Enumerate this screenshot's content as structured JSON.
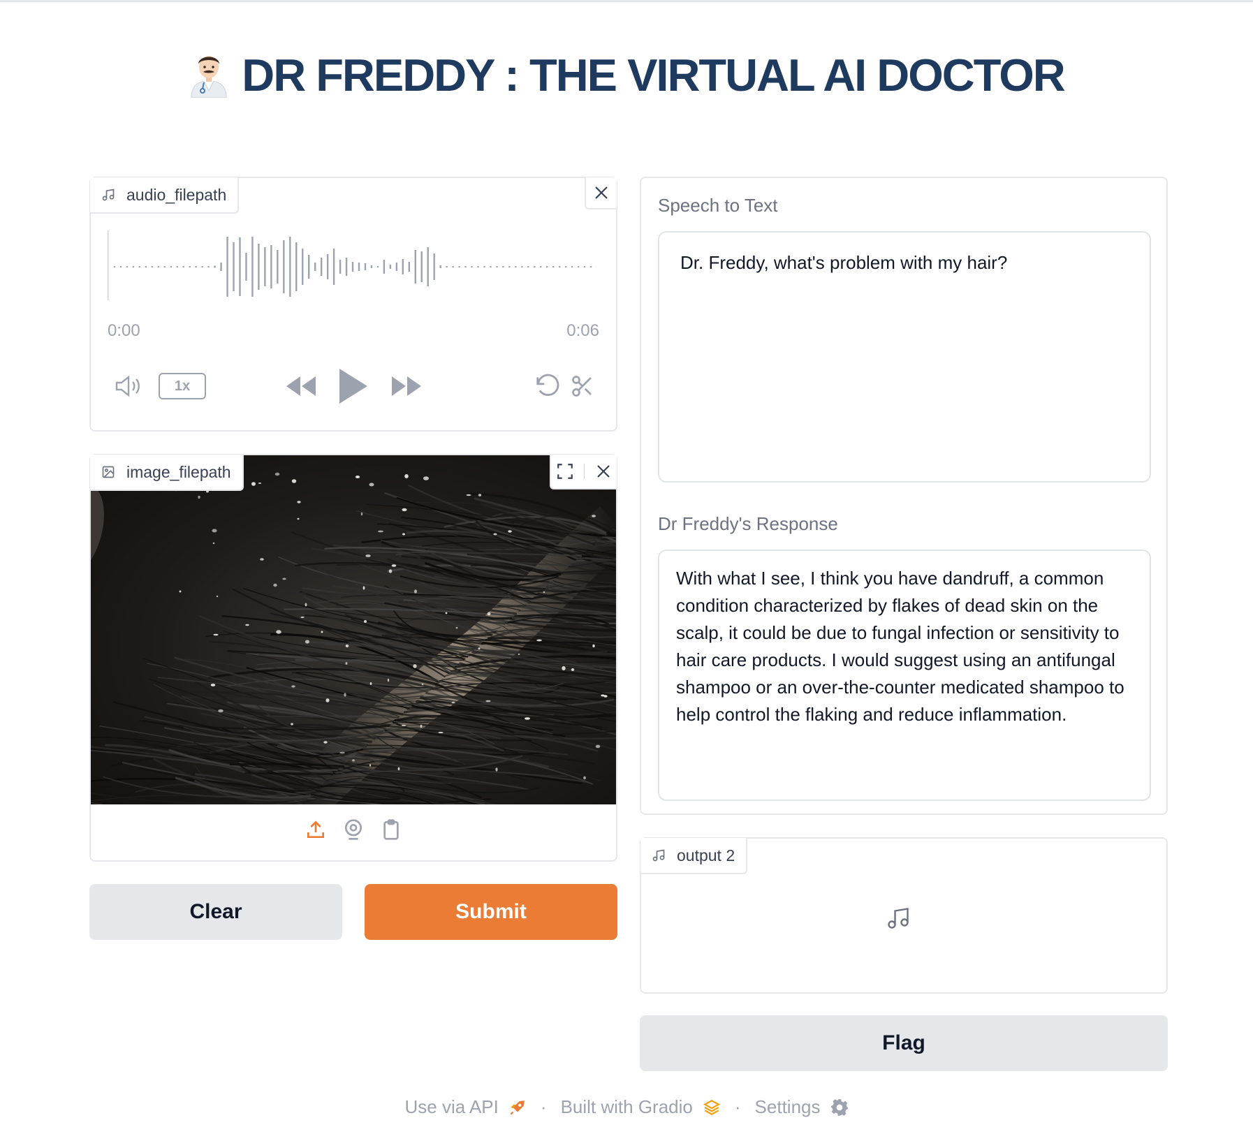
{
  "app": {
    "title": "DR FREDDY : THE VIRTUAL AI DOCTOR"
  },
  "audio": {
    "label": "audio_filepath",
    "time_start": "0:00",
    "time_end": "0:06",
    "speed": "1x"
  },
  "image": {
    "label": "image_filepath"
  },
  "buttons": {
    "clear": "Clear",
    "submit": "Submit",
    "flag": "Flag"
  },
  "speech_to_text": {
    "label": "Speech to Text",
    "value": "Dr. Freddy, what's problem with my hair?"
  },
  "response": {
    "label": "Dr Freddy's Response",
    "value": "With what I see, I think you have dandruff, a common condition characterized by flakes of dead skin on the scalp, it could be due to fungal infection or sensitivity to hair care products. I would suggest using an antifungal shampoo or an over-the-counter medicated shampoo to help control the flaking and reduce inflammation."
  },
  "output2": {
    "label": "output 2"
  },
  "footer": {
    "api": "Use via API",
    "built": "Built with Gradio",
    "settings": "Settings",
    "separator": "·"
  },
  "colors": {
    "accent": "#eb7c35",
    "title": "#1e3a5f",
    "muted": "#9ca3af"
  }
}
